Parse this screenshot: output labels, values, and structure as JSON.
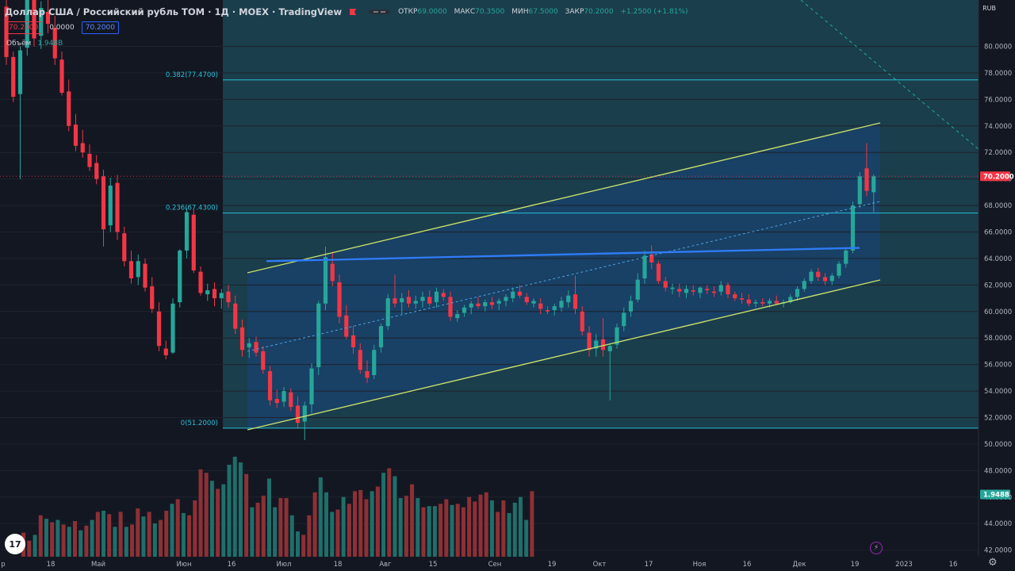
{
  "header": {
    "title": "Доллар США / Российский рубль TOM · 1Д · MOEX · TradingView",
    "ohlc": [
      {
        "label": "ОТКР",
        "value": "69.0000"
      },
      {
        "label": "МАКС",
        "value": "70.3500"
      },
      {
        "label": "МИН",
        "value": "67.5000"
      },
      {
        "label": "ЗАКР",
        "value": "70.2000"
      }
    ],
    "change": "+1.2500 (+1.81%)",
    "values": [
      "70.2000",
      "0.0000",
      "70.2000"
    ],
    "volume_label": "Объём",
    "volume_value": "1.948B",
    "currency": "RUB"
  },
  "colors": {
    "bg": "#131722",
    "up": "#26a69a",
    "down": "#f23645",
    "box": "#1c4552",
    "channel": "#c8e06a",
    "channel_fill": "#19426e",
    "fib": "#27c1d6",
    "trend": "#2f7cf6",
    "axis_text": "#b2b5be"
  },
  "icons": [
    "flag-icon",
    "minimize-icon",
    "tradingview-logo-icon",
    "lightning-icon",
    "settings-icon"
  ],
  "fib_levels": [
    {
      "label": "0.382(77.4700)",
      "price": 77.47
    },
    {
      "label": "0.236(67.4300)",
      "price": 67.43
    },
    {
      "label": "0(51.2000)",
      "price": 51.2
    }
  ],
  "price_labels": [
    {
      "text": "70.2000",
      "price": 70.2,
      "color": "#f23645"
    },
    {
      "text": "1.9488",
      "price": 46.2,
      "color": "#26a69a"
    }
  ],
  "chart_data": {
    "type": "candlestick",
    "symbol": "USDRUB_TOM",
    "interval": "1D",
    "y_range": [
      41.5,
      83.5
    ],
    "y_ticks": [
      42,
      44,
      46,
      48,
      50,
      52,
      54,
      56,
      58,
      60,
      62,
      64,
      66,
      68,
      70,
      72,
      74,
      76,
      78,
      80
    ],
    "x_labels": [
      "р",
      "18",
      "Май",
      "Июн",
      "16",
      "Июл",
      "18",
      "Авг",
      "15",
      "Сен",
      "19",
      "Окт",
      "17",
      "Ноя",
      "16",
      "Дек",
      "19",
      "2023",
      "16"
    ],
    "last_price": 70.2,
    "volume_last": "1.9488",
    "candles": [
      [
        83.0,
        83.6,
        78.6,
        79.2
      ],
      [
        79.2,
        79.6,
        75.8,
        76.2
      ],
      [
        76.4,
        80.0,
        70.0,
        79.7
      ],
      [
        79.9,
        84.2,
        79.3,
        83.8
      ],
      [
        83.8,
        84.6,
        80.0,
        80.6
      ],
      [
        80.8,
        83.4,
        79.8,
        82.9
      ],
      [
        82.6,
        84.0,
        81.0,
        81.7
      ],
      [
        81.4,
        82.3,
        78.6,
        79.1
      ],
      [
        79.0,
        79.6,
        76.3,
        76.5
      ],
      [
        76.6,
        77.5,
        73.6,
        74.0
      ],
      [
        74.1,
        74.9,
        72.1,
        72.5
      ],
      [
        72.7,
        73.7,
        71.6,
        72.0
      ],
      [
        71.9,
        72.6,
        70.6,
        70.9
      ],
      [
        71.2,
        71.8,
        69.6,
        70.0
      ],
      [
        70.2,
        70.7,
        64.9,
        66.2
      ],
      [
        66.5,
        70.1,
        66.0,
        69.5
      ],
      [
        69.7,
        70.3,
        65.4,
        66.0
      ],
      [
        65.9,
        66.4,
        63.4,
        63.8
      ],
      [
        63.8,
        64.6,
        62.1,
        62.5
      ],
      [
        62.6,
        64.3,
        62.0,
        63.8
      ],
      [
        63.6,
        64.0,
        61.5,
        61.8
      ],
      [
        61.9,
        62.6,
        59.9,
        60.2
      ],
      [
        60.0,
        60.7,
        57.0,
        57.4
      ],
      [
        57.2,
        57.8,
        56.4,
        56.7
      ],
      [
        56.9,
        61.0,
        56.8,
        60.6
      ],
      [
        60.7,
        64.7,
        60.3,
        64.6
      ],
      [
        64.6,
        67.8,
        64.0,
        67.5
      ],
      [
        67.3,
        67.7,
        62.9,
        63.1
      ],
      [
        63.0,
        63.4,
        61.2,
        61.4
      ],
      [
        61.3,
        62.1,
        60.8,
        61.6
      ],
      [
        61.7,
        62.2,
        60.4,
        61.0
      ],
      [
        61.0,
        61.7,
        60.2,
        61.4
      ],
      [
        61.5,
        62.0,
        60.3,
        60.7
      ],
      [
        60.6,
        61.2,
        58.3,
        58.7
      ],
      [
        58.8,
        59.4,
        56.6,
        57.1
      ],
      [
        57.3,
        58.0,
        56.5,
        57.6
      ],
      [
        57.7,
        58.1,
        56.6,
        56.9
      ],
      [
        57.0,
        57.4,
        55.3,
        55.6
      ],
      [
        55.5,
        55.9,
        52.9,
        53.3
      ],
      [
        53.4,
        54.1,
        52.7,
        53.1
      ],
      [
        53.2,
        54.3,
        52.8,
        54.0
      ],
      [
        53.9,
        54.2,
        52.5,
        52.8
      ],
      [
        52.9,
        53.6,
        51.2,
        51.6
      ],
      [
        51.7,
        53.2,
        50.3,
        52.9
      ],
      [
        53.0,
        56.1,
        52.3,
        55.7
      ],
      [
        55.8,
        60.8,
        55.2,
        60.6
      ],
      [
        60.6,
        64.9,
        60.1,
        64.1
      ],
      [
        63.6,
        64.5,
        61.9,
        62.3
      ],
      [
        62.2,
        62.8,
        59.1,
        59.6
      ],
      [
        59.7,
        60.5,
        57.9,
        58.1
      ],
      [
        58.2,
        58.9,
        56.8,
        57.3
      ],
      [
        57.1,
        57.6,
        55.3,
        55.6
      ],
      [
        55.5,
        56.3,
        54.6,
        55.0
      ],
      [
        55.2,
        57.5,
        54.9,
        57.1
      ],
      [
        57.3,
        59.1,
        56.9,
        58.9
      ],
      [
        58.9,
        61.3,
        58.6,
        61.0
      ],
      [
        61.0,
        62.8,
        60.3,
        60.6
      ],
      [
        60.7,
        61.4,
        59.8,
        61.0
      ],
      [
        61.1,
        61.6,
        60.3,
        60.6
      ],
      [
        60.6,
        61.2,
        60.2,
        60.8
      ],
      [
        60.8,
        61.5,
        60.3,
        61.1
      ],
      [
        61.1,
        61.6,
        60.4,
        60.6
      ],
      [
        60.7,
        61.8,
        60.3,
        61.5
      ],
      [
        61.4,
        61.7,
        60.8,
        61.1
      ],
      [
        61.1,
        61.5,
        59.3,
        59.6
      ],
      [
        59.5,
        60.1,
        59.2,
        59.8
      ],
      [
        59.9,
        60.5,
        59.6,
        60.3
      ],
      [
        60.3,
        60.8,
        59.8,
        60.6
      ],
      [
        60.6,
        61.1,
        60.2,
        60.4
      ],
      [
        60.4,
        60.9,
        60.0,
        60.7
      ],
      [
        60.7,
        61.1,
        60.2,
        60.5
      ],
      [
        60.6,
        61.0,
        60.1,
        60.8
      ],
      [
        60.8,
        61.3,
        60.4,
        61.1
      ],
      [
        61.0,
        61.8,
        60.7,
        61.5
      ],
      [
        61.5,
        62.0,
        61.0,
        61.2
      ],
      [
        61.1,
        61.4,
        60.5,
        60.7
      ],
      [
        60.6,
        61.0,
        60.3,
        60.8
      ],
      [
        60.6,
        61.0,
        59.8,
        60.2
      ],
      [
        60.1,
        60.4,
        59.8,
        60.0
      ],
      [
        60.1,
        60.6,
        59.7,
        60.4
      ],
      [
        60.3,
        61.1,
        60.0,
        60.8
      ],
      [
        60.7,
        61.6,
        60.3,
        61.2
      ],
      [
        61.3,
        62.7,
        59.8,
        60.2
      ],
      [
        60.0,
        60.4,
        58.2,
        58.5
      ],
      [
        58.4,
        58.9,
        56.6,
        57.1
      ],
      [
        57.2,
        58.3,
        56.6,
        57.8
      ],
      [
        57.9,
        59.5,
        56.6,
        57.1
      ],
      [
        57.0,
        57.6,
        53.3,
        57.4
      ],
      [
        57.5,
        59.1,
        57.2,
        58.8
      ],
      [
        58.9,
        60.3,
        58.5,
        59.9
      ],
      [
        60.0,
        61.2,
        59.6,
        60.8
      ],
      [
        60.9,
        62.9,
        60.7,
        62.4
      ],
      [
        62.5,
        64.6,
        62.1,
        64.2
      ],
      [
        64.3,
        65.0,
        63.2,
        63.7
      ],
      [
        63.6,
        63.8,
        62.1,
        62.3
      ],
      [
        62.3,
        62.6,
        61.5,
        61.8
      ],
      [
        61.7,
        62.1,
        61.3,
        61.8
      ],
      [
        61.7,
        62.1,
        61.1,
        61.5
      ],
      [
        61.4,
        62.0,
        61.0,
        61.7
      ],
      [
        61.6,
        62.0,
        61.2,
        61.5
      ],
      [
        61.4,
        61.9,
        61.0,
        61.8
      ],
      [
        61.7,
        62.0,
        61.3,
        61.6
      ],
      [
        61.5,
        61.9,
        61.1,
        61.4
      ],
      [
        61.5,
        62.3,
        61.2,
        62.0
      ],
      [
        62.0,
        62.2,
        61.0,
        61.3
      ],
      [
        61.3,
        61.5,
        60.8,
        61.0
      ],
      [
        61.0,
        61.4,
        60.6,
        60.9
      ],
      [
        60.9,
        61.3,
        60.4,
        60.6
      ],
      [
        60.6,
        60.9,
        60.3,
        60.7
      ],
      [
        60.7,
        61.0,
        60.4,
        60.6
      ],
      [
        60.6,
        61.0,
        60.3,
        60.8
      ],
      [
        60.8,
        61.2,
        60.5,
        60.6
      ],
      [
        60.6,
        60.9,
        60.3,
        60.7
      ],
      [
        60.7,
        61.3,
        60.6,
        61.1
      ],
      [
        61.1,
        61.9,
        60.8,
        61.7
      ],
      [
        61.7,
        62.5,
        61.5,
        62.3
      ],
      [
        62.3,
        63.2,
        62.1,
        63.0
      ],
      [
        63.0,
        63.3,
        62.3,
        62.6
      ],
      [
        62.6,
        62.9,
        62.0,
        62.3
      ],
      [
        62.3,
        62.9,
        62.0,
        62.7
      ],
      [
        62.7,
        63.8,
        62.5,
        63.6
      ],
      [
        63.6,
        64.8,
        63.3,
        64.6
      ],
      [
        64.6,
        68.3,
        64.4,
        68.0
      ],
      [
        68.1,
        70.5,
        67.8,
        70.2
      ],
      [
        70.8,
        72.7,
        68.7,
        69.1
      ],
      [
        69.0,
        70.35,
        67.5,
        70.2
      ]
    ],
    "volume": [
      [
        44.1,
        0
      ],
      [
        43.4,
        0
      ],
      [
        43.9,
        1
      ],
      [
        45.6,
        0
      ],
      [
        45.3,
        1
      ],
      [
        45.0,
        0
      ],
      [
        45.2,
        1
      ],
      [
        44.8,
        0
      ],
      [
        44.6,
        1
      ],
      [
        45.1,
        0
      ],
      [
        44.3,
        1
      ],
      [
        44.7,
        0
      ],
      [
        45.2,
        1
      ],
      [
        45.9,
        0
      ],
      [
        46.0,
        1
      ],
      [
        45.7,
        0
      ],
      [
        44.6,
        1
      ],
      [
        45.9,
        0
      ],
      [
        44.6,
        1
      ],
      [
        44.8,
        0
      ],
      [
        46.2,
        0
      ],
      [
        45.5,
        1
      ],
      [
        45.9,
        0
      ],
      [
        44.9,
        1
      ],
      [
        45.2,
        0
      ],
      [
        46.0,
        0
      ],
      [
        46.6,
        1
      ],
      [
        47.0,
        0
      ],
      [
        45.8,
        1
      ],
      [
        45.6,
        0
      ],
      [
        46.9,
        0
      ],
      [
        49.6,
        0
      ],
      [
        49.3,
        0
      ],
      [
        48.6,
        1
      ],
      [
        47.9,
        0
      ],
      [
        48.3,
        1
      ],
      [
        50.0,
        1
      ],
      [
        50.7,
        1
      ],
      [
        50.2,
        1
      ],
      [
        49.2,
        0
      ],
      [
        46.3,
        1
      ],
      [
        46.7,
        0
      ],
      [
        47.3,
        0
      ],
      [
        48.8,
        1
      ],
      [
        46.3,
        1
      ],
      [
        47.1,
        0
      ],
      [
        47.1,
        0
      ],
      [
        45.6,
        1
      ],
      [
        44.2,
        1
      ],
      [
        43.9,
        0
      ],
      [
        45.6,
        0
      ],
      [
        47.6,
        0
      ],
      [
        48.9,
        1
      ],
      [
        47.6,
        1
      ],
      [
        45.9,
        1
      ],
      [
        46.1,
        0
      ],
      [
        47.2,
        1
      ],
      [
        46.6,
        0
      ],
      [
        47.7,
        0
      ],
      [
        47.8,
        0
      ],
      [
        47.0,
        0
      ],
      [
        47.7,
        1
      ],
      [
        48.1,
        0
      ],
      [
        49.3,
        1
      ],
      [
        49.7,
        0
      ],
      [
        49.0,
        1
      ],
      [
        47.1,
        1
      ],
      [
        47.3,
        0
      ],
      [
        48.3,
        0
      ],
      [
        47.1,
        1
      ],
      [
        46.3,
        0
      ],
      [
        46.4,
        1
      ],
      [
        46.4,
        1
      ],
      [
        46.6,
        0
      ],
      [
        47.0,
        0
      ],
      [
        46.5,
        1
      ],
      [
        46.6,
        0
      ],
      [
        46.3,
        0
      ],
      [
        47.2,
        0
      ],
      [
        46.8,
        0
      ],
      [
        47.4,
        0
      ],
      [
        47.6,
        0
      ],
      [
        46.9,
        1
      ],
      [
        45.9,
        0
      ],
      [
        46.9,
        0
      ],
      [
        45.8,
        1
      ],
      [
        46.7,
        1
      ],
      [
        47.2,
        1
      ],
      [
        45.2,
        1
      ],
      [
        47.7,
        0
      ]
    ]
  }
}
